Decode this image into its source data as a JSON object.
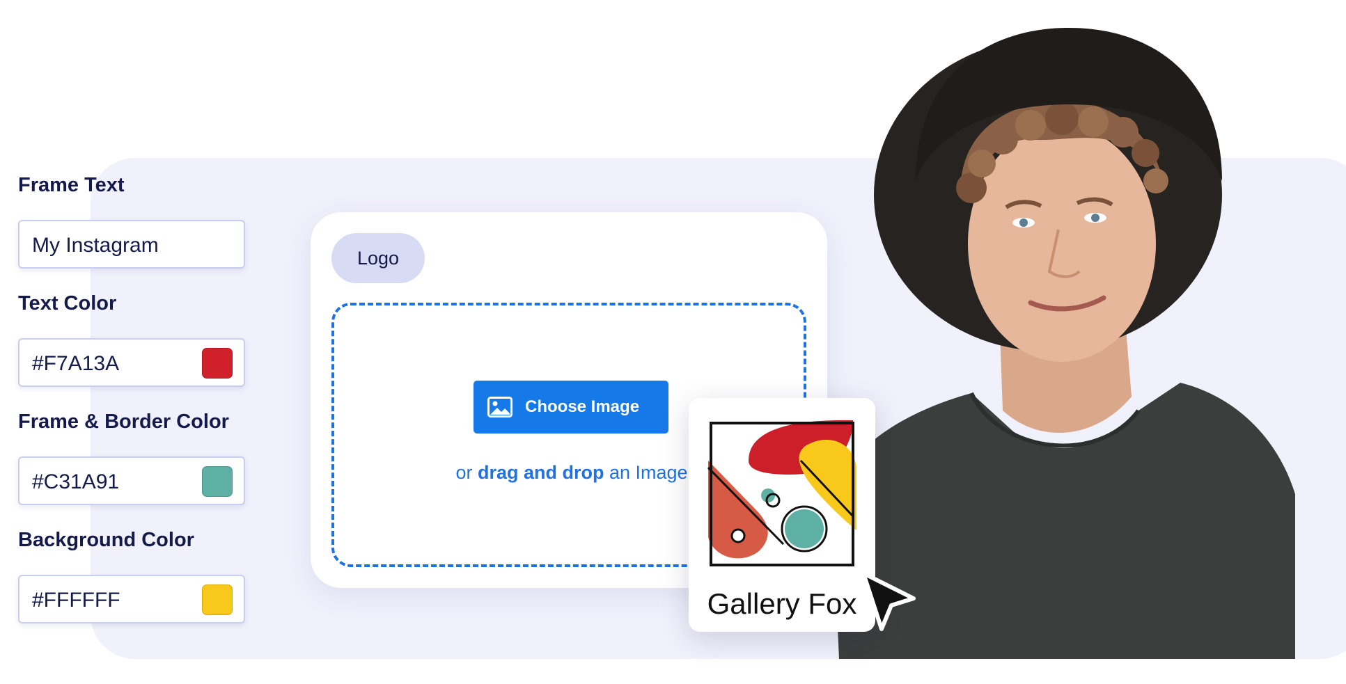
{
  "settings": {
    "frame_text": {
      "label": "Frame Text",
      "value": "My Instagram"
    },
    "text_color": {
      "label": "Text Color",
      "value": "#F7A13A",
      "swatch": "#d0202a"
    },
    "frame_border_color": {
      "label": "Frame & Border Color",
      "value": "#C31A91",
      "swatch": "#5fb0a4"
    },
    "background_color": {
      "label": "Background Color",
      "value": "#FFFFFF",
      "swatch": "#f8c91a"
    }
  },
  "upload": {
    "logo_label": "Logo",
    "choose_button": "Choose Image",
    "drop_prefix": "or",
    "drop_bold": "drag and drop",
    "drop_suffix": "an Image"
  },
  "preview": {
    "caption": "Gallery Fox"
  },
  "icons": {
    "image": "image-icon",
    "cursor": "cursor-arrow-icon"
  },
  "colors": {
    "accent": "#1579e8",
    "panel_bg": "#f0f1fb",
    "text_dark": "#141a4a"
  }
}
